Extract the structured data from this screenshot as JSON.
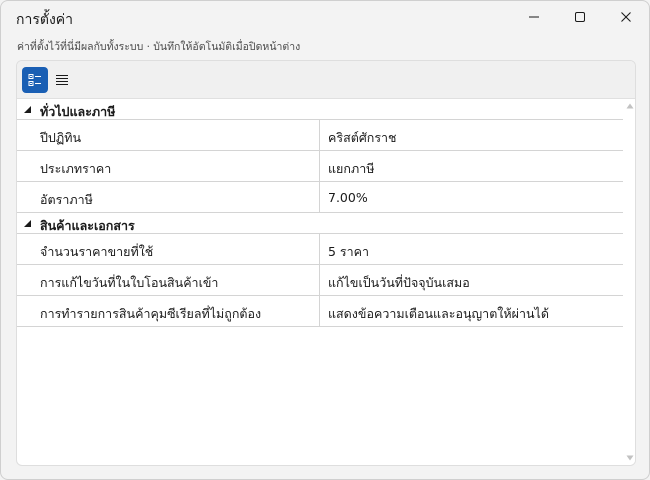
{
  "window": {
    "title": "การตั้งค่า"
  },
  "subtitle": "ค่าที่ตั้งไว้ที่นี่มีผลกับทั้งระบบ · บันทึกให้อัตโนมัติเมื่อปิดหน้าต่าง",
  "toolbar": {
    "categorized_icon": "categorized-view-icon",
    "alphabetical_icon": "alphabetical-view-icon"
  },
  "categories": [
    {
      "label": "ทั่วไปและภาษี",
      "properties": [
        {
          "name": "ปีปฏิทิน",
          "value": "คริสต์ศักราช"
        },
        {
          "name": "ประเภทราคา",
          "value": "แยกภาษี"
        },
        {
          "name": "อัตราภาษี",
          "value": "7.00%"
        }
      ]
    },
    {
      "label": "สินค้าและเอกสาร",
      "properties": [
        {
          "name": "จำนวนราคาขายที่ใช้",
          "value": "5 ราคา"
        },
        {
          "name": "การแก้ไขวันที่ในใบโอนสินค้าเข้า",
          "value": "แก้ไขเป็นวันที่ปัจจุบันเสมอ"
        },
        {
          "name": "การทำรายการสินค้าคุมซีเรียลที่ไม่ถูกต้อง",
          "value": "แสดงข้อความเตือนและอนุญาตให้ผ่านได้"
        }
      ]
    }
  ],
  "colors": {
    "accent": "#1a5fb4",
    "background": "#f3f3f3",
    "grid_line": "#d4d4d4"
  }
}
